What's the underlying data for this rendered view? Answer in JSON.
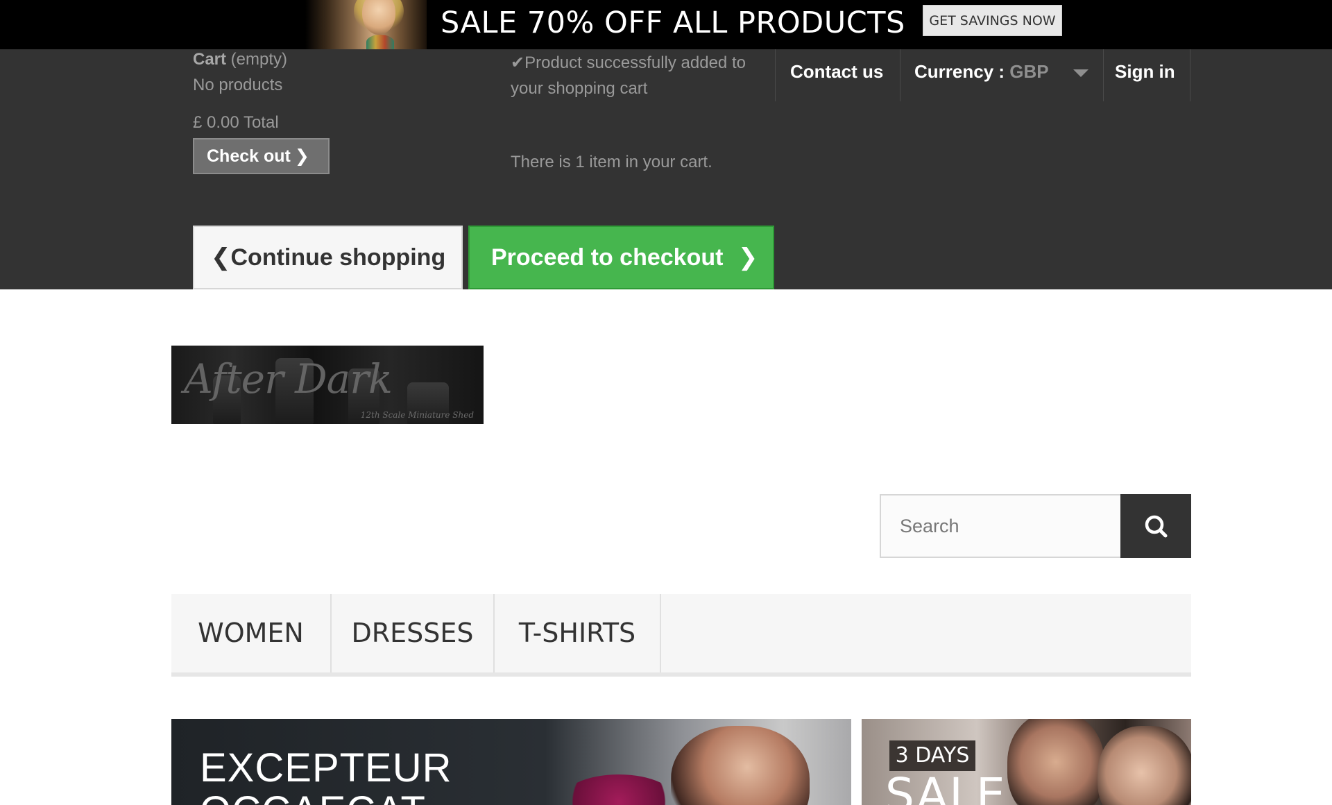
{
  "promo": {
    "title": "SALE 70% OFF ALL PRODUCTS",
    "button_label": "GET SAVINGS NOW"
  },
  "cart": {
    "title_bold": "Cart",
    "title_state": " (empty)",
    "no_products": "No products",
    "total": "£ 0.00 Total",
    "checkout_label": "Check out",
    "added_message": "Product successfully added to your shopping cart",
    "item_count_text": "There is 1 item in your cart.",
    "continue_label": "Continue shopping",
    "proceed_label": "Proceed to checkout"
  },
  "header_nav": {
    "contact": "Contact us",
    "currency_label": "Currency :",
    "currency_value": "GBP",
    "sign_in": "Sign in"
  },
  "logo": {
    "text": "After Dark",
    "subtext": "12th Scale Miniature Shed"
  },
  "search": {
    "placeholder": "Search"
  },
  "menu": {
    "items": [
      "WOMEN",
      "DRESSES",
      "T-SHIRTS"
    ]
  },
  "hero": {
    "main_title_line1": "EXCEPTEUR",
    "main_title_line2": "OCCAECAT",
    "side_badge": "3 DAYS",
    "side_text": "SALE"
  },
  "colors": {
    "topbar_bg": "#333333",
    "proceed_green": "#46b64e",
    "search_button_bg": "#333333"
  },
  "icons": [
    "check-icon",
    "chevron-right-icon",
    "chevron-left-icon",
    "caret-down-icon",
    "search-icon"
  ]
}
